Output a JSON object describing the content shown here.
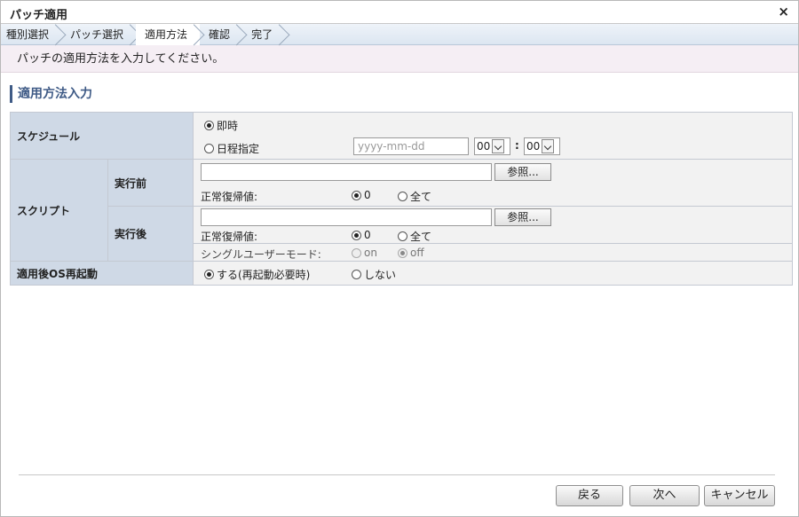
{
  "window": {
    "title": "パッチ適用",
    "close_glyph": "×"
  },
  "steps": [
    {
      "label": "種別選択",
      "active": false
    },
    {
      "label": "パッチ選択",
      "active": false
    },
    {
      "label": "適用方法",
      "active": true
    },
    {
      "label": "確認",
      "active": false
    },
    {
      "label": "完了",
      "active": false
    }
  ],
  "instruction": "パッチの適用方法を入力してください。",
  "section_title": "適用方法入力",
  "schedule": {
    "label": "スケジュール",
    "option_immediate": "即時",
    "option_date": "日程指定",
    "selected": "immediate",
    "date_placeholder": "yyyy-mm-dd",
    "hour": "00",
    "minute": "00",
    "time_sep": ":"
  },
  "script": {
    "label": "スクリプト",
    "before": {
      "label": "実行前",
      "browse": "参照...",
      "return_label": "正常復帰値:",
      "opt_zero": "0",
      "opt_all": "全て",
      "selected": "zero"
    },
    "after": {
      "label": "実行後",
      "browse": "参照...",
      "return_label": "正常復帰値:",
      "opt_zero": "0",
      "opt_all": "全て",
      "selected": "zero",
      "single_user_label": "シングルユーザーモード:",
      "opt_on": "on",
      "opt_off": "off",
      "single_selected": "off"
    }
  },
  "reboot": {
    "label": "適用後OS再起動",
    "opt_yes": "する(再起動必要時)",
    "opt_no": "しない",
    "selected": "yes"
  },
  "footer": {
    "back": "戻る",
    "next": "次へ",
    "cancel": "キャンセル"
  }
}
